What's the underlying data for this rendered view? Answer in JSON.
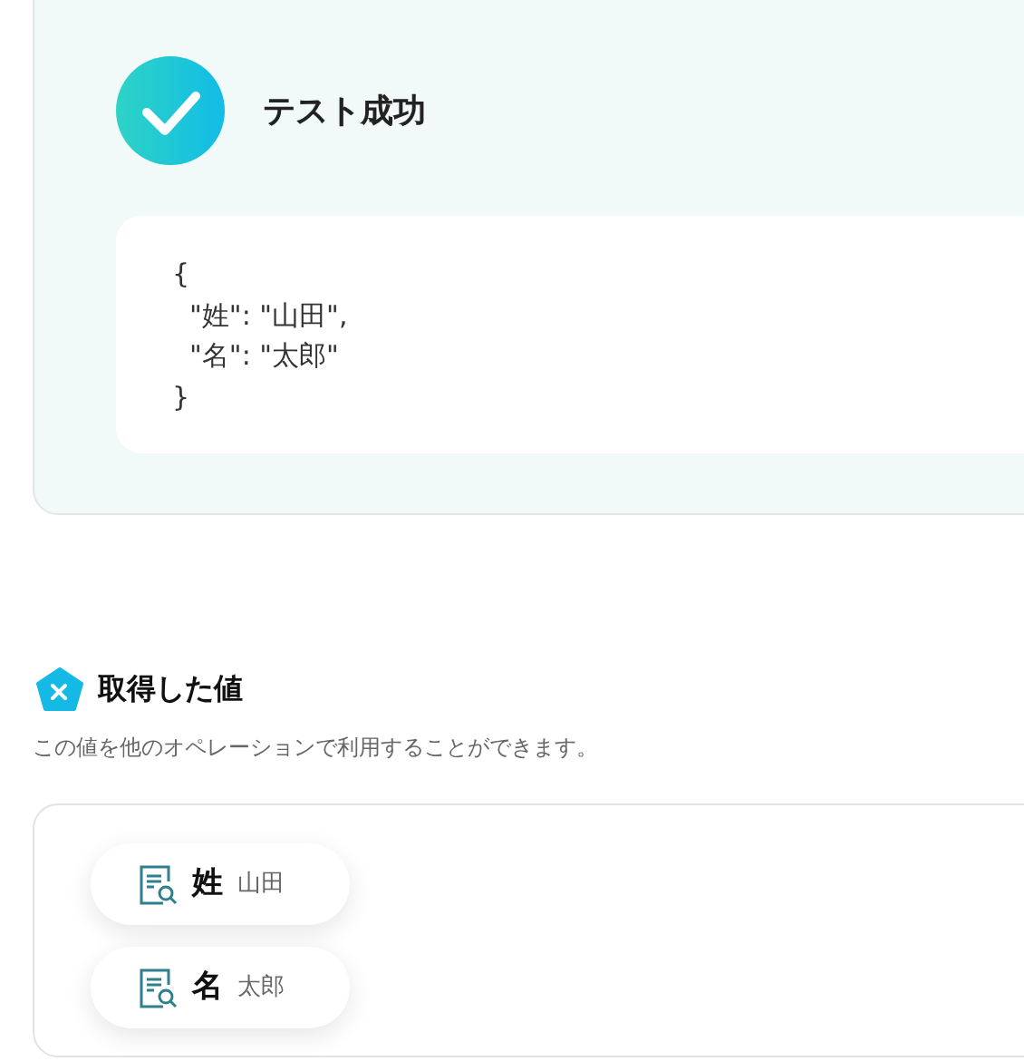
{
  "test_result": {
    "title": "テスト成功",
    "code_lines": [
      "{",
      "  \"姓\": \"山田\",",
      "  \"名\": \"太郎\"",
      "}"
    ]
  },
  "output": {
    "title": "取得した値",
    "description": "この値を他のオペレーションで利用することができます。",
    "values": [
      {
        "key": "姓",
        "value": "山田"
      },
      {
        "key": "名",
        "value": "太郎"
      }
    ]
  }
}
